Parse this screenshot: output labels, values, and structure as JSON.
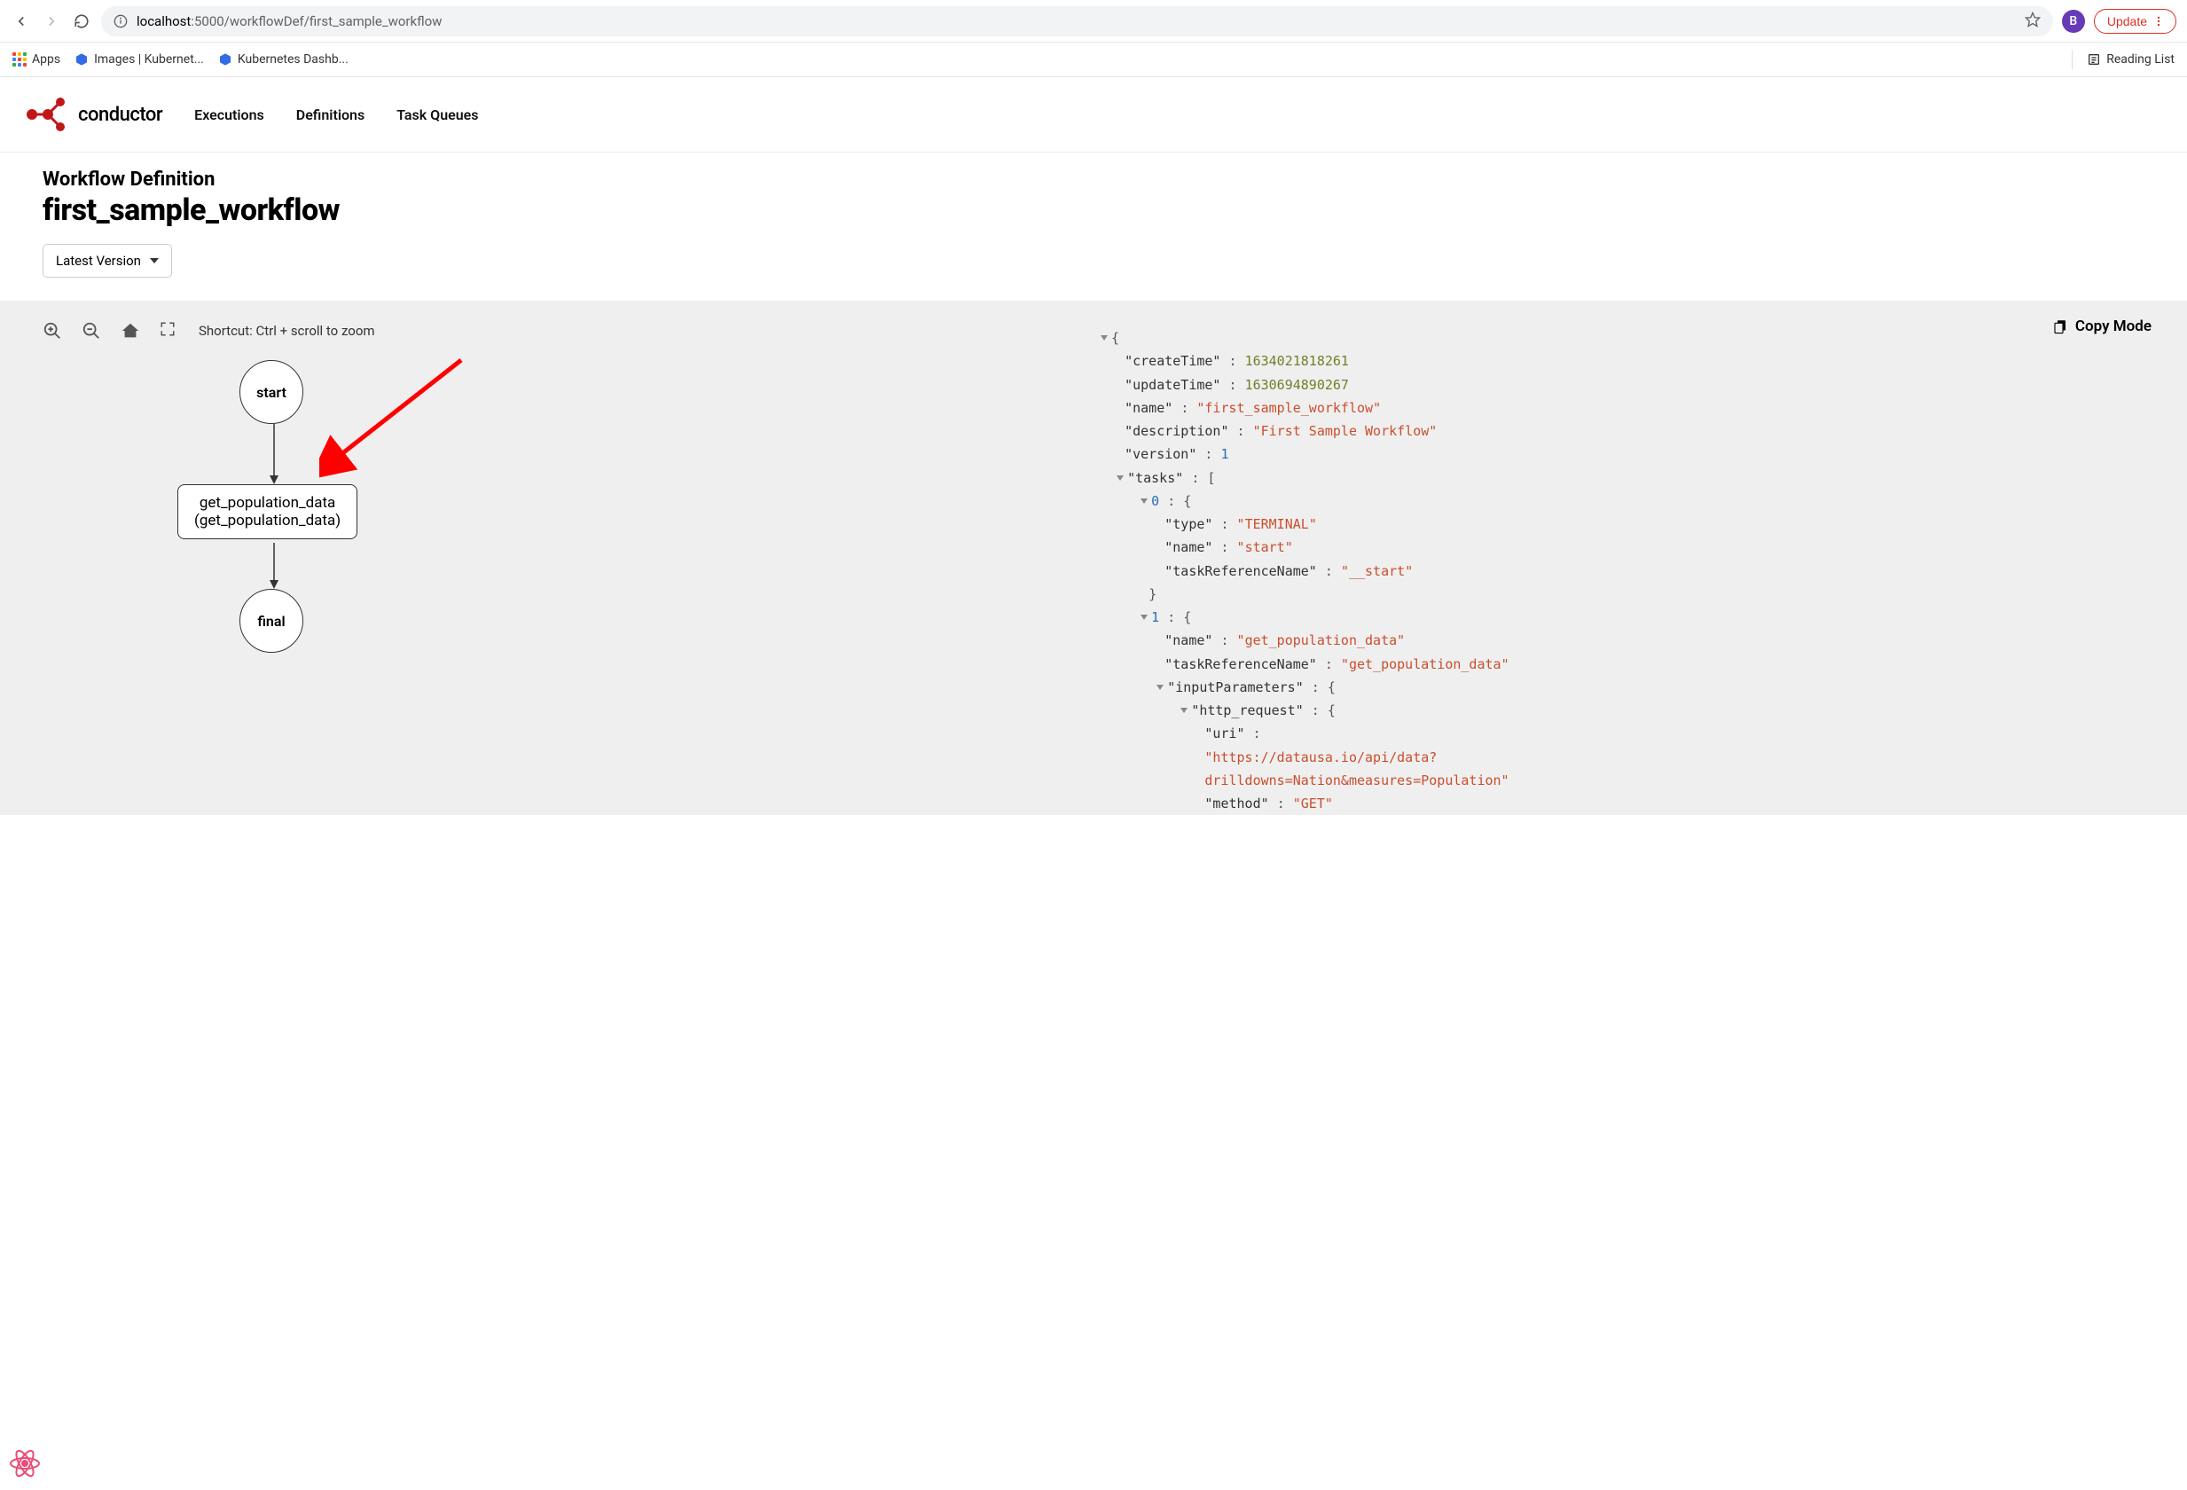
{
  "browser": {
    "url_host": "localhost",
    "url_port_path": ":5000/workflowDef/first_sample_workflow",
    "profile_initial": "B",
    "update_label": "Update"
  },
  "bookmarks": {
    "apps": "Apps",
    "images_kubernetes": "Images | Kubernet...",
    "kubernetes_dashboard": "Kubernetes Dashb...",
    "reading_list": "Reading List"
  },
  "nav": {
    "brand": "conductor",
    "executions": "Executions",
    "definitions": "Definitions",
    "task_queues": "Task Queues"
  },
  "page": {
    "subtitle": "Workflow Definition",
    "title": "first_sample_workflow",
    "version_label": "Latest Version"
  },
  "canvas": {
    "shortcut_hint": "Shortcut: Ctrl + scroll to zoom",
    "start_label": "start",
    "task_label_line1": "get_population_data",
    "task_label_line2": "(get_population_data)",
    "final_label": "final"
  },
  "json_panel": {
    "copy_mode": "Copy Mode"
  },
  "workflow_def": {
    "createTime": 1634021818261,
    "updateTime": 1630694890267,
    "name": "first_sample_workflow",
    "description": "First Sample Workflow",
    "version": 1,
    "tasks": [
      {
        "type": "TERMINAL",
        "name": "start",
        "taskReferenceName": "__start"
      },
      {
        "name": "get_population_data",
        "taskReferenceName": "get_population_data",
        "inputParameters": {
          "http_request": {
            "uri": "https://datausa.io/api/data?drilldowns=Nation&measures=Population",
            "method": "GET"
          }
        }
      }
    ]
  }
}
